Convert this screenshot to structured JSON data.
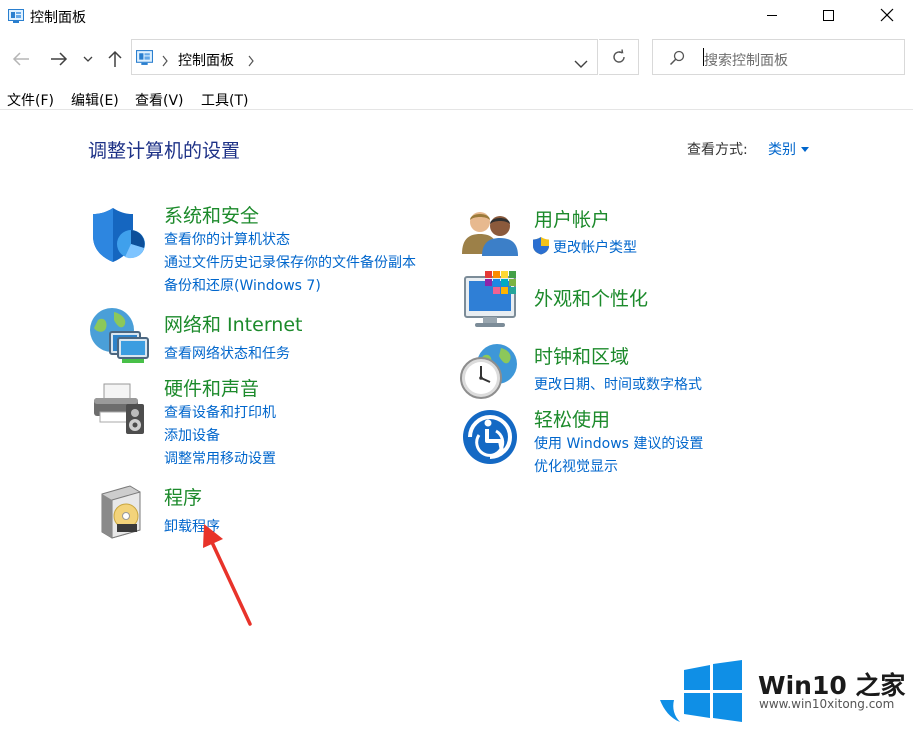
{
  "window": {
    "title": "控制面板",
    "minimize_icon": "minimize-icon",
    "maximize_icon": "maximize-icon",
    "close_icon": "close-icon"
  },
  "nav": {
    "back_icon": "arrow-left-icon",
    "forward_icon": "arrow-right-icon",
    "recent_icon": "chevron-down-icon",
    "up_icon": "arrow-up-icon"
  },
  "address": {
    "crumb": "控制面板",
    "refresh_icon": "refresh-icon"
  },
  "search": {
    "placeholder": "搜索控制面板"
  },
  "menu": [
    {
      "label": "文件(F)"
    },
    {
      "label": "编辑(E)"
    },
    {
      "label": "查看(V)"
    },
    {
      "label": "工具(T)"
    }
  ],
  "main": {
    "title": "调整计算机的设置",
    "view_by_label": "查看方式:",
    "view_by_value": "类别"
  },
  "categories_left": [
    {
      "title": "系统和安全",
      "icon": "shield-icon",
      "links": [
        "查看你的计算机状态",
        "通过文件历史记录保存你的文件备份副本",
        "备份和还原(Windows 7)"
      ]
    },
    {
      "title": "网络和 Internet",
      "icon": "network-globe-icon",
      "links": [
        "查看网络状态和任务"
      ]
    },
    {
      "title": "硬件和声音",
      "icon": "printer-icon",
      "links": [
        "查看设备和打印机",
        "添加设备",
        "调整常用移动设置"
      ]
    },
    {
      "title": "程序",
      "icon": "programs-disc-icon",
      "links": [
        "卸载程序"
      ]
    }
  ],
  "categories_right": [
    {
      "title": "用户帐户",
      "icon": "users-icon",
      "links": [
        "更改帐户类型"
      ]
    },
    {
      "title": "外观和个性化",
      "icon": "monitor-palette-icon",
      "links": []
    },
    {
      "title": "时钟和区域",
      "icon": "clock-globe-icon",
      "links": [
        "更改日期、时间或数字格式"
      ]
    },
    {
      "title": "轻松使用",
      "icon": "ease-of-access-icon",
      "links": [
        "使用 Windows 建议的设置",
        "优化视觉显示"
      ]
    }
  ],
  "watermark": {
    "brand": "Win10 之家",
    "url": "www.win10xitong.com",
    "colors": {
      "blue": "#0f8fe6",
      "red_arrow": "#e8332a"
    }
  }
}
